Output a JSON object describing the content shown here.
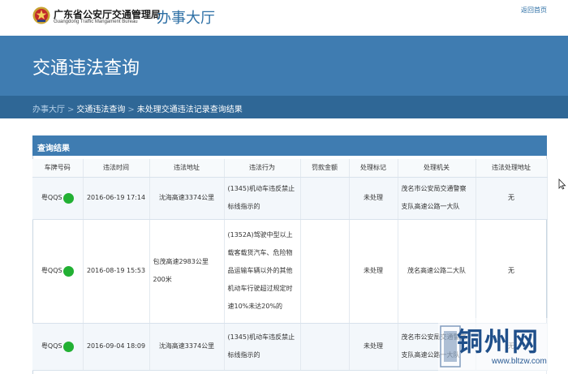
{
  "header": {
    "org_name_cn": "广东省公安厅交通管理局",
    "org_name_en": "Guangdong Traffic Mangament Bureau",
    "hall_title": "办事大厅",
    "back_home": "返回首页"
  },
  "banner": {
    "title": "交通违法查询"
  },
  "breadcrumb": {
    "items": [
      "办事大厅",
      "交通违法查询",
      "未处理交通违法记录查询结果"
    ],
    "separator": ">"
  },
  "results": {
    "panel_title": "查询结果",
    "columns": [
      "车牌号码",
      "违法时间",
      "违法地址",
      "违法行为",
      "罚款金额",
      "处理标记",
      "处理机关",
      "违法处理地址"
    ],
    "rows": [
      {
        "plate": "粤QQS",
        "time": "2016-06-19 17:14",
        "address": "沈海高速3374公里",
        "behavior": "(1345)机动车违反禁止标线指示的",
        "fine": "",
        "status": "未处理",
        "office": "茂名市公安局交通警察支队高速公路一大队",
        "handle_address": "无"
      },
      {
        "plate": "粤QQS",
        "time": "2016-08-19 15:53",
        "address": "包茂高速2983公里200米",
        "behavior": "(1352A)驾驶中型以上载客载货汽车、危险物品运输车辆以外的其他机动车行驶超过规定时速10%未达20%的",
        "fine": "",
        "status": "未处理",
        "office": "茂名高速公路二大队",
        "handle_address": "无"
      },
      {
        "plate": "粤QQS",
        "time": "2016-09-04 18:09",
        "address": "沈海高速3374公里",
        "behavior": "(1345)机动车违反禁止标线指示的",
        "fine": "",
        "status": "未处理",
        "office": "茂名市公安局交通警察支队高速公路一大队",
        "handle_address": "无"
      }
    ]
  },
  "watermark": {
    "text": "铜州网",
    "url": "www.bltzw.com"
  },
  "colors": {
    "banner": "#3f7cb1",
    "breadcrumb_bar": "#2f6796",
    "accent": "#2d6fa5",
    "plate_dot": "#22b033"
  },
  "icons": {
    "emblem": "police-emblem-icon",
    "cursor": "mouse-cursor-icon",
    "plate_mask": "green-dot-icon"
  }
}
